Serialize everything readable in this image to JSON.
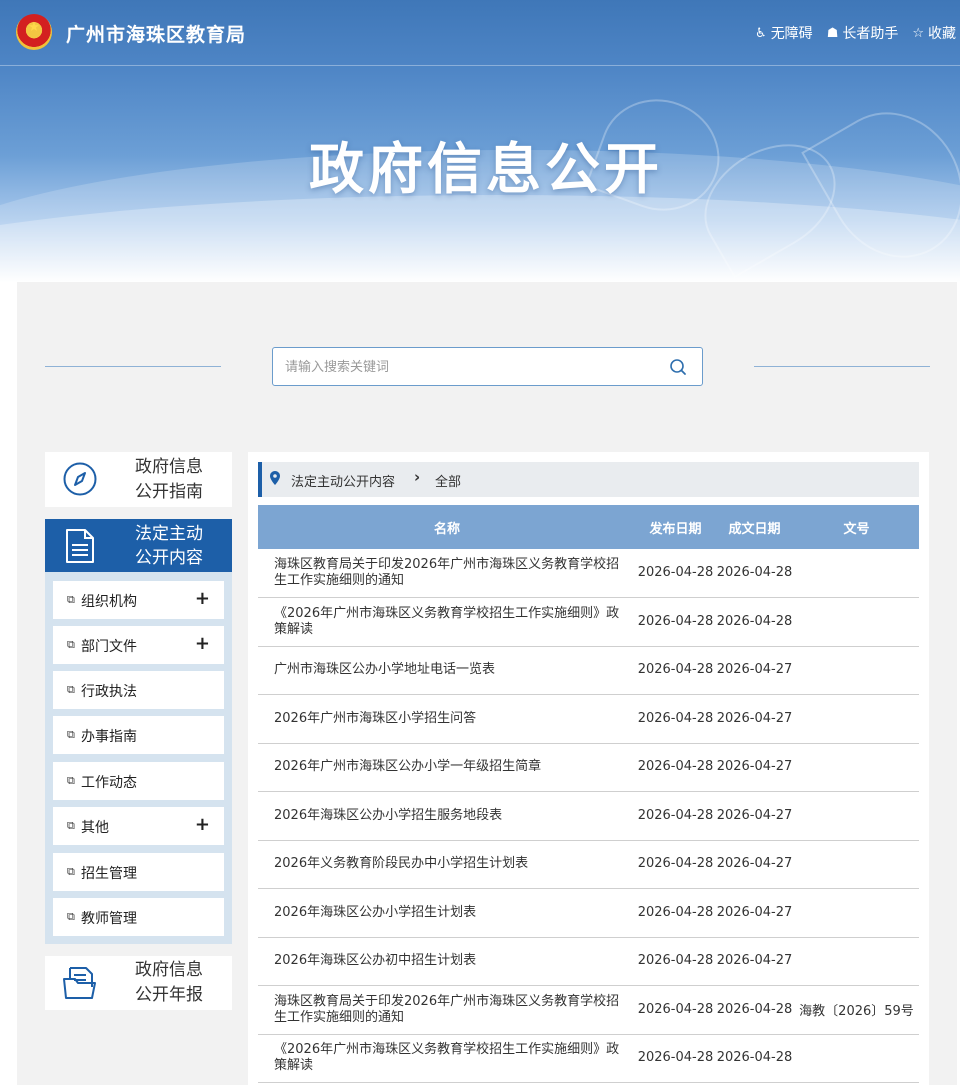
{
  "header": {
    "site_name": "广州市海珠区教育局",
    "tools": [
      {
        "icon": "accessibility-icon",
        "label": "无障碍"
      },
      {
        "icon": "elder-helper-icon",
        "label": "长者助手"
      },
      {
        "icon": "star-icon",
        "label": "收藏"
      }
    ],
    "hero_title": "政府信息公开"
  },
  "search": {
    "placeholder": "请输入搜索关键词",
    "value": ""
  },
  "sidebar": {
    "guide": {
      "label_line1": "政府信息",
      "label_line2": "公开指南",
      "icon": "compass-icon"
    },
    "active_section": {
      "label_line1": "法定主动",
      "label_line2": "公开内容",
      "icon": "document-icon"
    },
    "menu": [
      {
        "label": "组织机构",
        "expandable": true
      },
      {
        "label": "部门文件",
        "expandable": true
      },
      {
        "label": "行政执法",
        "expandable": false
      },
      {
        "label": "办事指南",
        "expandable": false
      },
      {
        "label": "工作动态",
        "expandable": false
      },
      {
        "label": "其他",
        "expandable": true
      },
      {
        "label": "招生管理",
        "expandable": false
      },
      {
        "label": "教师管理",
        "expandable": false
      }
    ],
    "annual_report": {
      "label_line1": "政府信息",
      "label_line2": "公开年报",
      "icon": "folder-icon"
    }
  },
  "breadcrumb": {
    "parent": "法定主动公开内容",
    "current": "全部"
  },
  "table": {
    "columns": [
      "名称",
      "发布日期",
      "成文日期",
      "文号"
    ],
    "rows": [
      {
        "name": "海珠区教育局关于印发2026年广州市海珠区义务教育学校招生工作实施细则的通知",
        "publish": "2026-04-28",
        "written": "2026-04-28",
        "doc_no": ""
      },
      {
        "name": "《2026年广州市海珠区义务教育学校招生工作实施细则》政策解读",
        "publish": "2026-04-28",
        "written": "2026-04-28",
        "doc_no": ""
      },
      {
        "name": "广州市海珠区公办小学地址电话一览表",
        "publish": "2026-04-28",
        "written": "2026-04-27",
        "doc_no": ""
      },
      {
        "name": "2026年广州市海珠区小学招生问答",
        "publish": "2026-04-28",
        "written": "2026-04-27",
        "doc_no": ""
      },
      {
        "name": "2026年广州市海珠区公办小学一年级招生简章",
        "publish": "2026-04-28",
        "written": "2026-04-27",
        "doc_no": ""
      },
      {
        "name": "2026年海珠区公办小学招生服务地段表",
        "publish": "2026-04-28",
        "written": "2026-04-27",
        "doc_no": ""
      },
      {
        "name": "2026年义务教育阶段民办中小学招生计划表",
        "publish": "2026-04-28",
        "written": "2026-04-27",
        "doc_no": ""
      },
      {
        "name": "2026年海珠区公办小学招生计划表",
        "publish": "2026-04-28",
        "written": "2026-04-27",
        "doc_no": ""
      },
      {
        "name": "2026年海珠区公办初中招生计划表",
        "publish": "2026-04-28",
        "written": "2026-04-27",
        "doc_no": ""
      },
      {
        "name": "海珠区教育局关于印发2026年广州市海珠区义务教育学校招生工作实施细则的通知",
        "publish": "2026-04-28",
        "written": "2026-04-28",
        "doc_no": "海教〔2026〕59号"
      },
      {
        "name": "《2026年广州市海珠区义务教育学校招生工作实施细则》政策解读",
        "publish": "2026-04-28",
        "written": "2026-04-28",
        "doc_no": ""
      }
    ]
  },
  "colors": {
    "brand_blue": "#1d5fa8",
    "header_row": "#7ca5d2",
    "panel_bg": "#f2f2f2"
  }
}
